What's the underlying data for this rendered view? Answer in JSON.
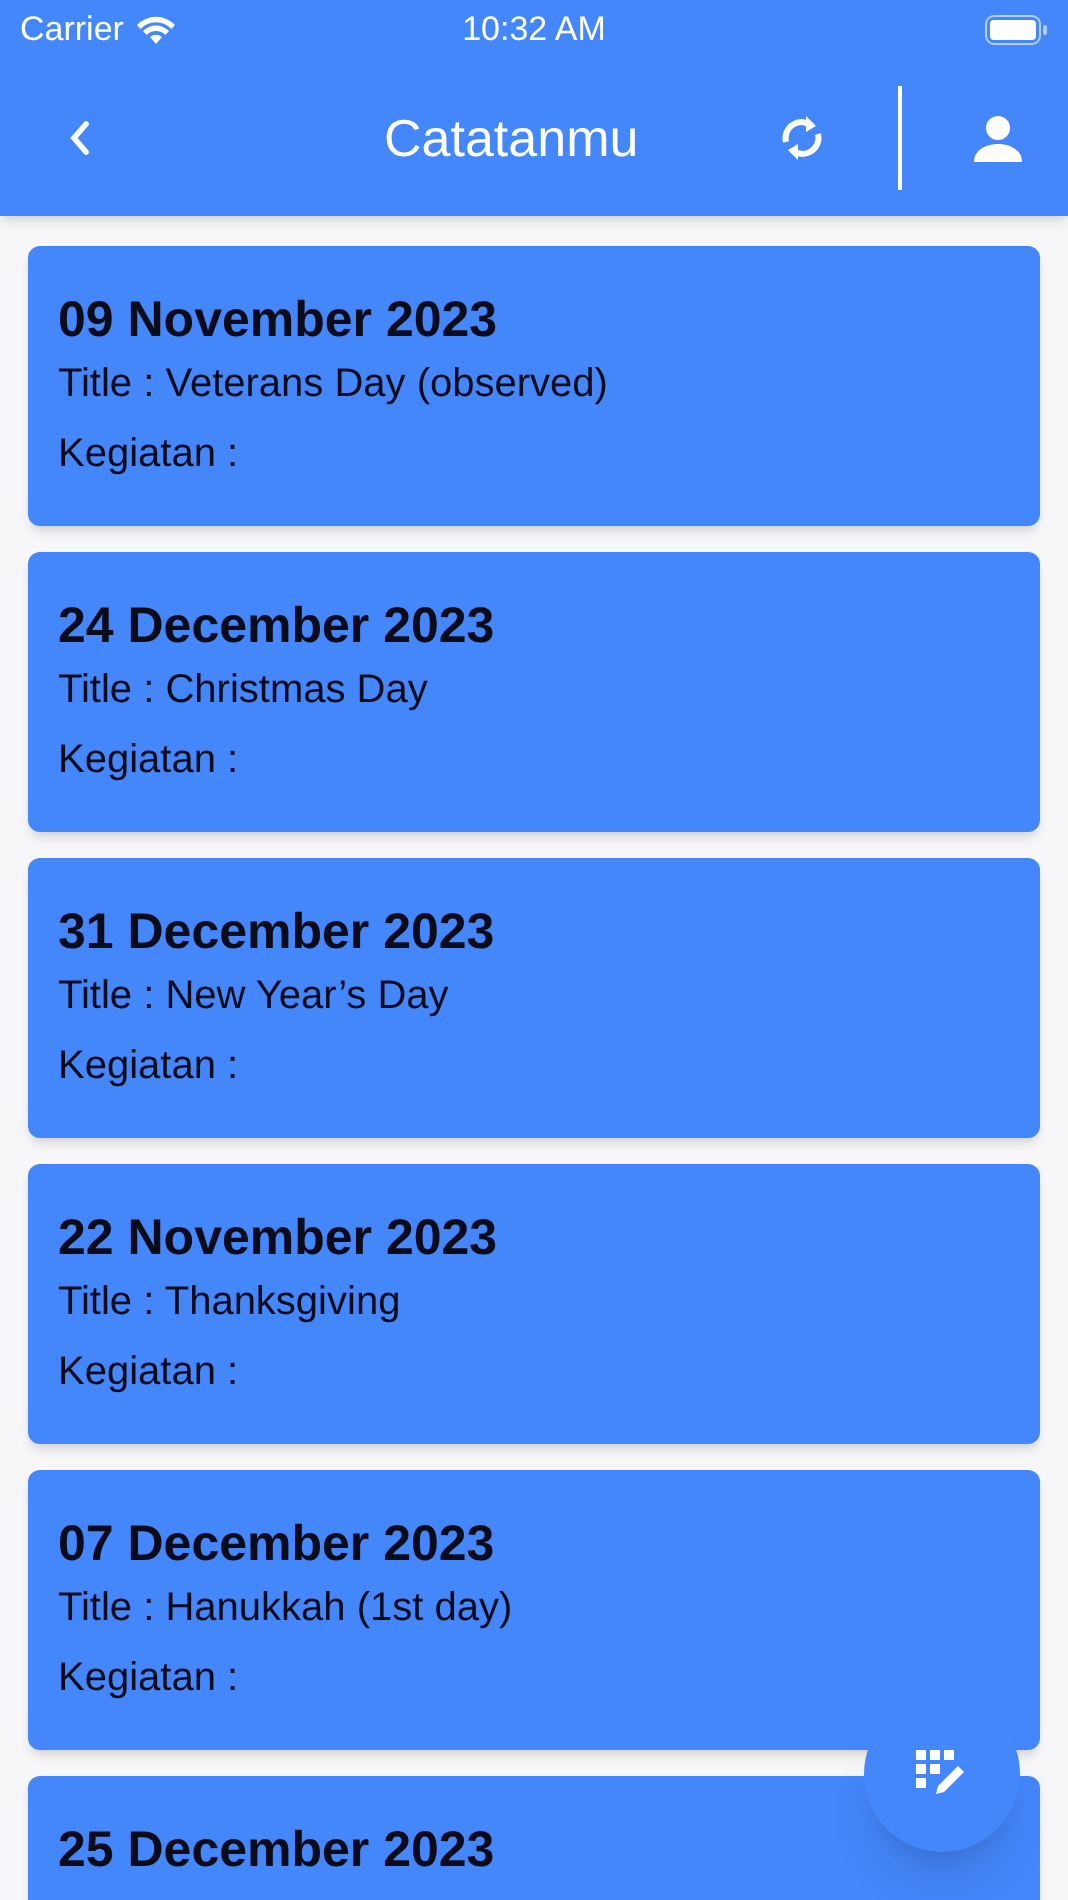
{
  "status_bar": {
    "carrier": "Carrier",
    "time": "10:32 AM"
  },
  "app_bar": {
    "title": "Catatanmu"
  },
  "notes": [
    {
      "date": "09 November 2023",
      "title": "Title : Veterans Day (observed)",
      "activity": "Kegiatan :"
    },
    {
      "date": "24 December 2023",
      "title": "Title : Christmas Day",
      "activity": "Kegiatan :"
    },
    {
      "date": "31 December 2023",
      "title": "Title : New Year’s Day",
      "activity": "Kegiatan :"
    },
    {
      "date": "22 November 2023",
      "title": "Title : Thanksgiving",
      "activity": "Kegiatan :"
    },
    {
      "date": "07 December 2023",
      "title": "Title : Hanukkah (1st day)",
      "activity": "Kegiatan :"
    },
    {
      "date": "25 December 2023"
    }
  ]
}
